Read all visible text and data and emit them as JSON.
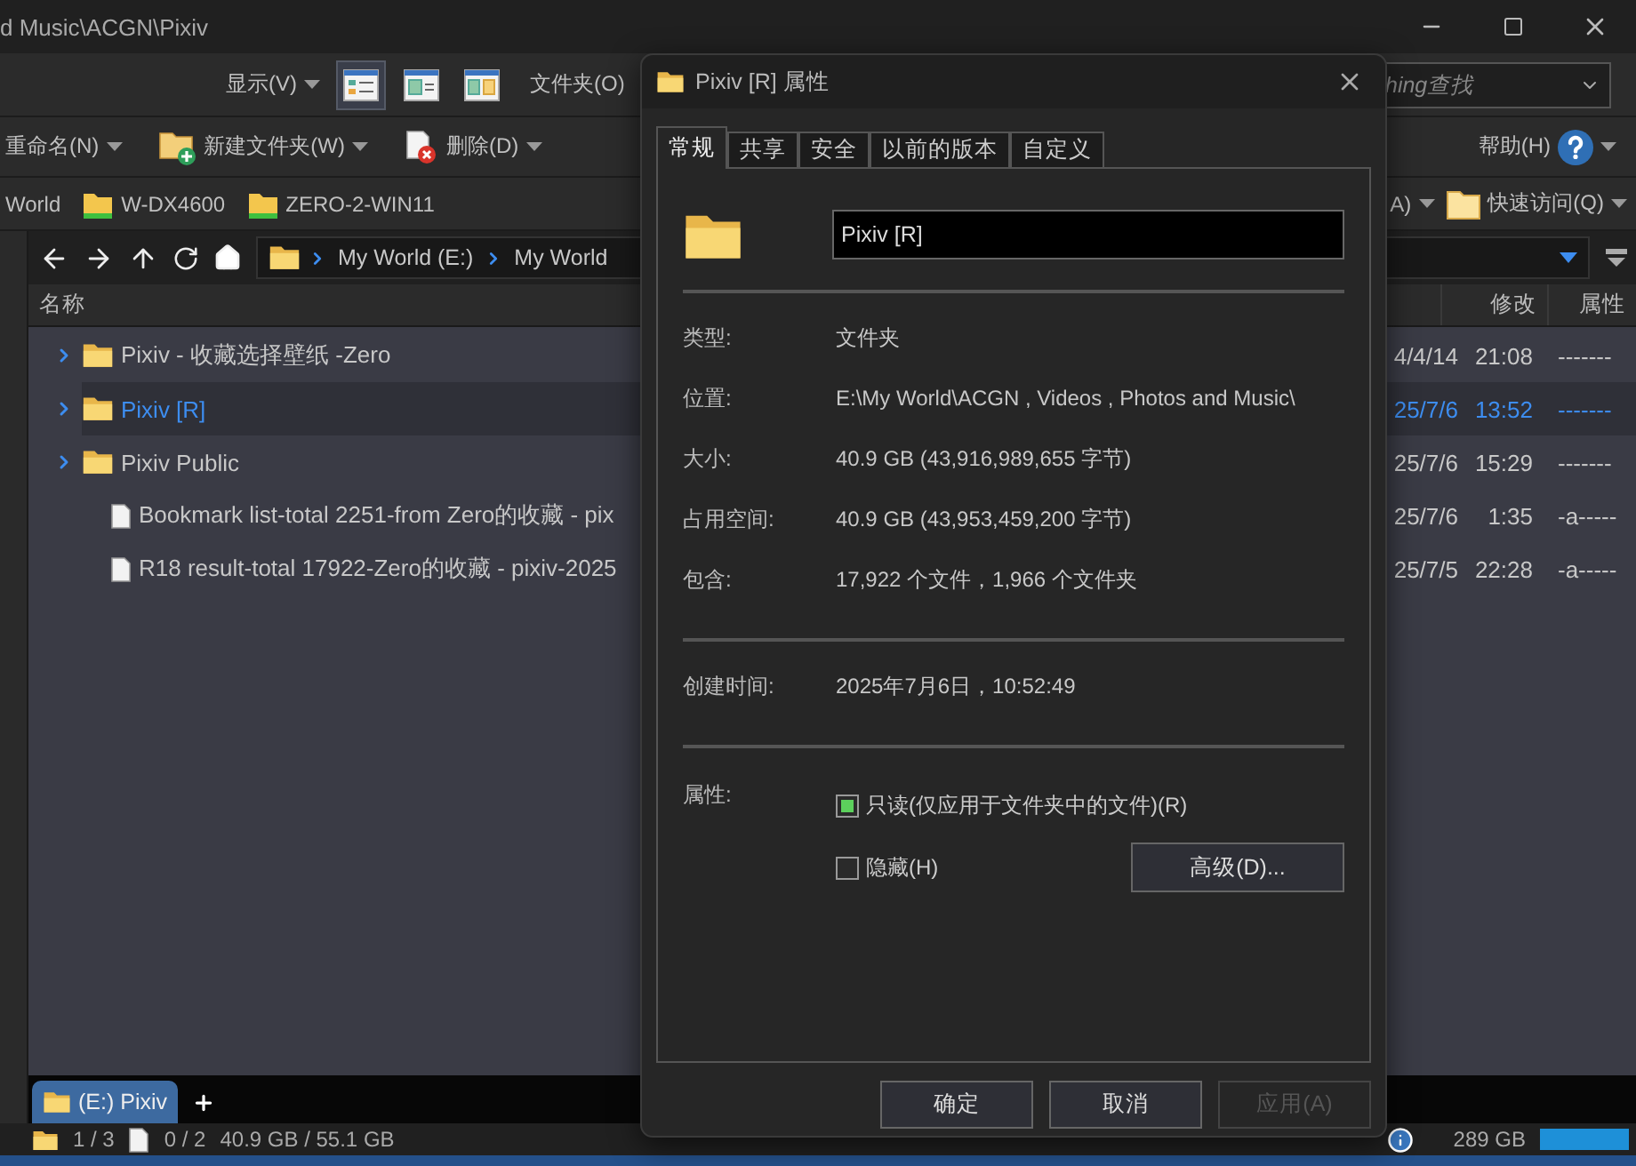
{
  "window": {
    "title": "d Music\\ACGN\\Pixiv"
  },
  "toolbar": {
    "view_menu": "显示(V)",
    "view_modes": [
      {
        "selected": true
      },
      {
        "selected": false
      },
      {
        "selected": false
      }
    ],
    "folder_menu": "文件夹(O)",
    "search": {
      "placeholder": "hing查找"
    }
  },
  "commands": [
    {
      "label": "重命名(N)",
      "kind": "plain"
    },
    {
      "label": "新建文件夹(W)",
      "kind": "new-folder"
    },
    {
      "label": "删除(D)",
      "kind": "delete"
    }
  ],
  "help": "帮助(H)",
  "favorites": [
    {
      "label": "World",
      "kind": "text"
    },
    {
      "label": "W-DX4600",
      "kind": "drive"
    },
    {
      "label": "ZERO-2-WIN11",
      "kind": "drive"
    }
  ],
  "favorites_right": [
    {
      "label": "A)",
      "kind": "menu"
    },
    {
      "label": "快速访问(Q)",
      "kind": "folder"
    }
  ],
  "breadcrumb": [
    "My World (E:)",
    "My World"
  ],
  "columns": {
    "name": "名称",
    "modified": "修改",
    "attributes": "属性"
  },
  "files": [
    {
      "name": "Pixiv - 收藏选择壁纸 -Zero",
      "kind": "folder",
      "selected": false,
      "date": "4/4/14",
      "time": "21:08",
      "attributes": "-------"
    },
    {
      "name": "Pixiv [R]",
      "kind": "folder",
      "selected": true,
      "date": "25/7/6",
      "time": "13:52",
      "attributes": "-------"
    },
    {
      "name": "Pixiv Public",
      "kind": "folder",
      "selected": false,
      "date": "25/7/6",
      "time": "15:29",
      "attributes": "-------"
    },
    {
      "name": "Bookmark list-total 2251-from Zero的收藏 - pix",
      "kind": "file",
      "selected": false,
      "date": "25/7/6",
      "time": "1:35",
      "attributes": "-a-----"
    },
    {
      "name": "R18 result-total 17922-Zero的收藏 - pixiv-2025",
      "kind": "file",
      "selected": false,
      "date": "25/7/5",
      "time": "22:28",
      "attributes": "-a-----"
    }
  ],
  "tabs": [
    {
      "label": "(E:) Pixiv",
      "selected": true
    }
  ],
  "status": {
    "folders": "1 / 3",
    "files": "0 / 2",
    "size": "40.9 GB / 55.1 GB",
    "free": "289 GB"
  },
  "dialog": {
    "title": "Pixiv [R] 属性",
    "tabs": [
      {
        "label": "常规",
        "selected": true
      },
      {
        "label": "共享",
        "selected": false
      },
      {
        "label": "安全",
        "selected": false
      },
      {
        "label": "以前的版本",
        "selected": false
      },
      {
        "label": "自定义",
        "selected": false
      }
    ],
    "name": "Pixiv [R]",
    "groups": [
      [
        {
          "label": "类型:",
          "value": "文件夹"
        },
        {
          "label": "位置:",
          "value": "E:\\My World\\ACGN , Videos , Photos and Music\\"
        },
        {
          "label": "大小:",
          "value": "40.9 GB (43,916,989,655 字节)"
        },
        {
          "label": "占用空间:",
          "value": "40.9 GB (43,953,459,200 字节)"
        },
        {
          "label": "包含:",
          "value": "17,922 个文件，1,966 个文件夹"
        }
      ],
      [
        {
          "label": "创建时间:",
          "value": "2025年7月6日，10:52:49"
        }
      ]
    ],
    "attributes_label": "属性:",
    "checkboxes": [
      {
        "label": "只读(仅应用于文件夹中的文件)(R)",
        "checked": true
      },
      {
        "label": "隐藏(H)",
        "checked": false
      }
    ],
    "advanced_button": "高级(D)...",
    "buttons": [
      {
        "label": "确定",
        "disabled": false
      },
      {
        "label": "取消",
        "disabled": false
      },
      {
        "label": "应用(A)",
        "disabled": true
      }
    ]
  }
}
